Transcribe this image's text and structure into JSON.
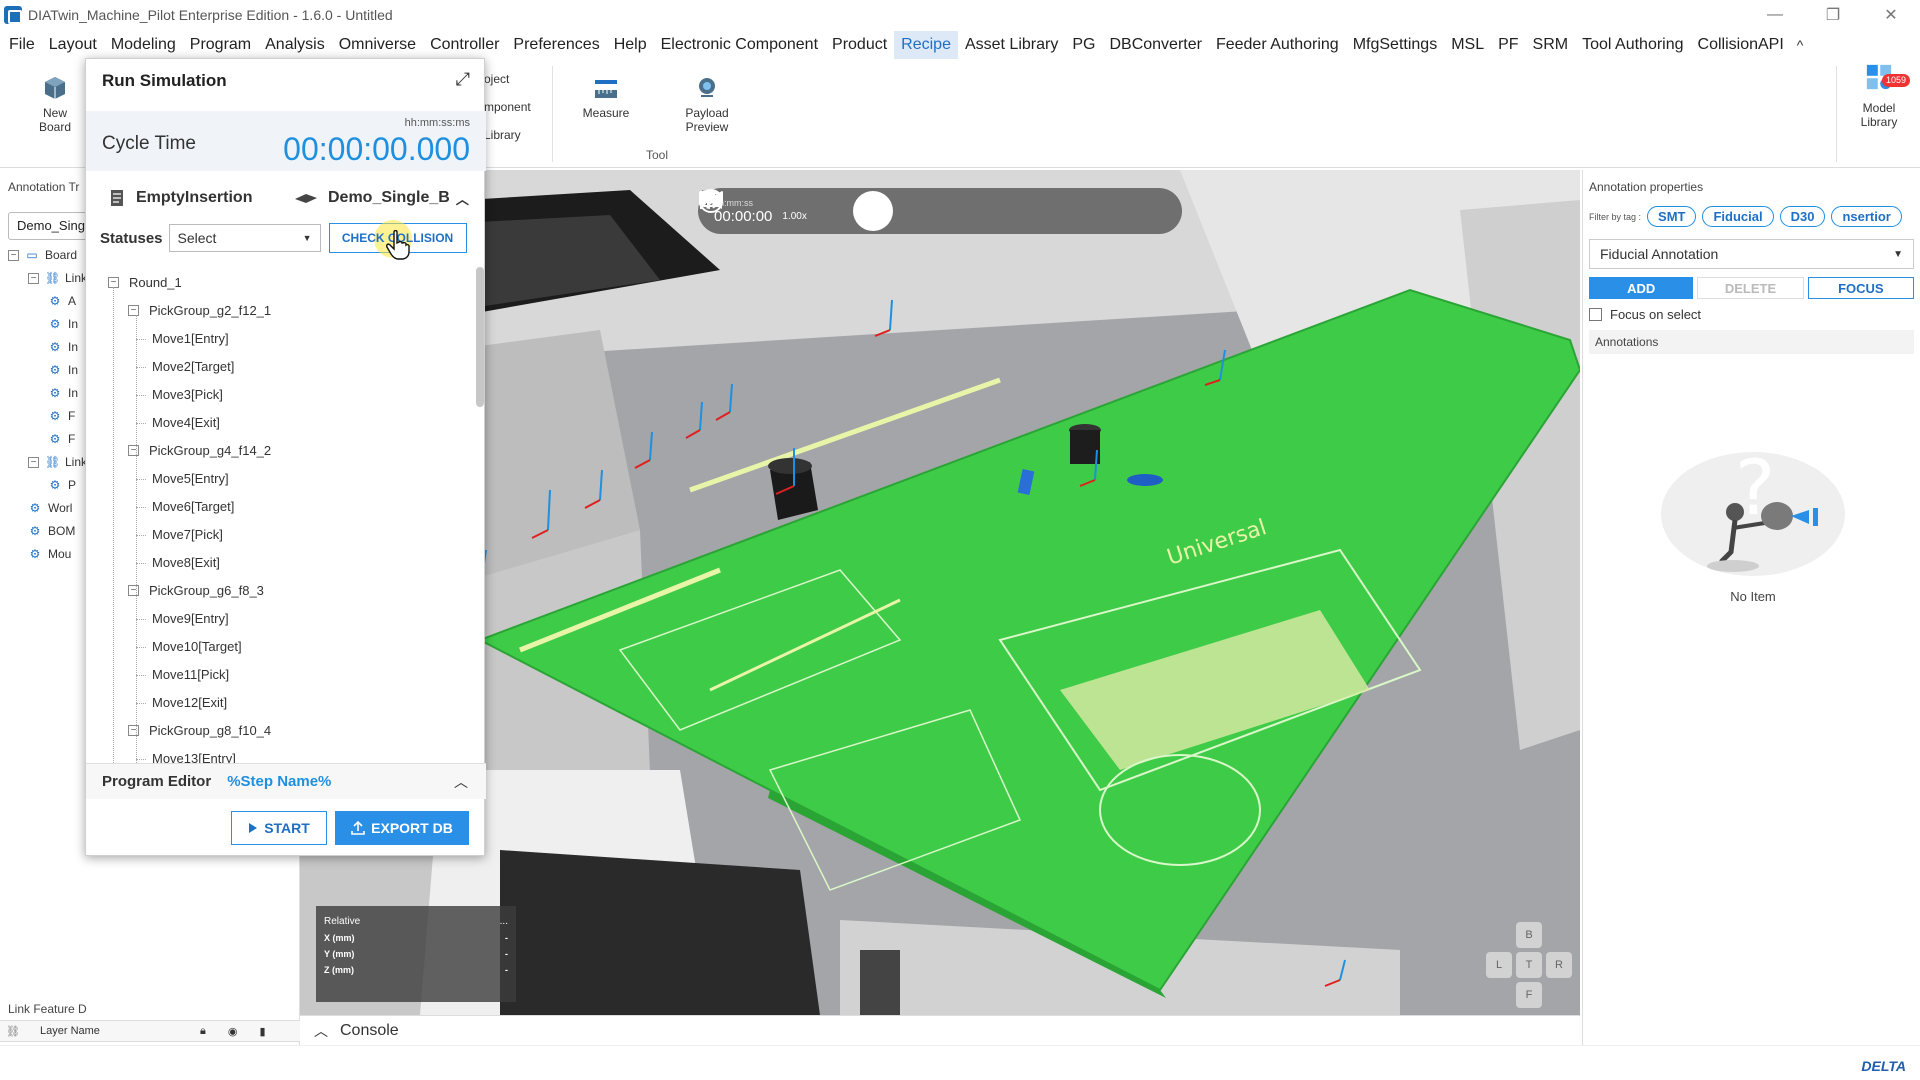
{
  "window": {
    "title": "DIATwin_Machine_Pilot Enterprise Edition - 1.6.0 - Untitled",
    "minimize_icon": "—",
    "restore_icon": "❐",
    "close_icon": "✕"
  },
  "menu": {
    "items": [
      "File",
      "Layout",
      "Modeling",
      "Program",
      "Analysis",
      "Omniverse",
      "Controller",
      "Preferences",
      "Help",
      "Electronic Component",
      "Product",
      "Recipe",
      "Asset Library",
      "PG",
      "DBConverter",
      "Feeder Authoring",
      "MfgSettings",
      "MSL",
      "PF",
      "SRM",
      "Tool Authoring",
      "CollisionAPI"
    ],
    "active": "Recipe",
    "collapse_icon": "^"
  },
  "ribbon": {
    "new_board": "New\nBoard",
    "object_frag": "oject",
    "component_frag": "mponent",
    "library_frag": "Library",
    "measure": "Measure",
    "payload_preview": "Payload\nPreview",
    "tool_group": "Tool",
    "model_library": "Model\nLibrary",
    "model_library_badge": "1059"
  },
  "left_panel": {
    "header": "Annotation Tr",
    "combo_value": "Demo_Sing",
    "tree": [
      {
        "label": "Board",
        "level": 0,
        "toggle": "-"
      },
      {
        "label": "Link_",
        "level": 1,
        "toggle": "-"
      },
      {
        "label": "A",
        "level": 2
      },
      {
        "label": "In",
        "level": 2
      },
      {
        "label": "In",
        "level": 2
      },
      {
        "label": "In",
        "level": 2
      },
      {
        "label": "In",
        "level": 2
      },
      {
        "label": "F",
        "level": 2
      },
      {
        "label": "F",
        "level": 2
      },
      {
        "label": "Link_",
        "level": 1,
        "toggle": "-"
      },
      {
        "label": "P",
        "level": 2
      },
      {
        "label": "Worl",
        "level": 1
      },
      {
        "label": "BOM",
        "level": 1
      },
      {
        "label": "Mou",
        "level": 1
      }
    ],
    "link_feature_title": "Link Feature D",
    "layer_col": "Layer Name"
  },
  "viewport": {
    "playbar": {
      "unit": "hh:mm:ss",
      "time": "00:00:00",
      "speed": "1.00x"
    },
    "coords": {
      "title": "Relative",
      "x_label": "X (mm)",
      "y_label": "Y (mm)",
      "z_label": "Z (mm)",
      "x_val": "-",
      "y_val": "-",
      "z_val": "-",
      "menu": "..."
    },
    "viewcube": {
      "back": "B",
      "left": "L",
      "top": "T",
      "right": "R",
      "front": "F"
    },
    "pcb_color": "#3ecb48"
  },
  "console": {
    "label": "Console"
  },
  "right_panel": {
    "title": "Annotation properties",
    "filter_label": "Filter by tag :",
    "tags": [
      "SMT",
      "Fiducial",
      "D30",
      "nsertior"
    ],
    "annotation_type": "Fiducial Annotation",
    "add": "ADD",
    "delete": "DELETE",
    "focus": "FOCUS",
    "focus_on_select": "Focus on select",
    "annotations_section": "Annotations",
    "empty_text": "No Item"
  },
  "sim_dialog": {
    "title": "Run Simulation",
    "cycle_label": "Cycle Time",
    "cycle_unit": "hh:mm:ss:ms",
    "cycle_value": "00:00:00.000",
    "recipe_name": "EmptyInsertion",
    "board_name": "Demo_Single_B",
    "statuses_label": "Statuses",
    "statuses_value": "Select",
    "check_collision": "CHECK COLLISION",
    "tree": [
      {
        "label": "Round_1",
        "kind": "round"
      },
      {
        "label": "PickGroup_g2_f12_1",
        "kind": "group"
      },
      {
        "label": "Move1[Entry]",
        "kind": "move"
      },
      {
        "label": "Move2[Target]",
        "kind": "move"
      },
      {
        "label": "Move3[Pick]",
        "kind": "move"
      },
      {
        "label": "Move4[Exit]",
        "kind": "move"
      },
      {
        "label": "PickGroup_g4_f14_2",
        "kind": "group"
      },
      {
        "label": "Move5[Entry]",
        "kind": "move"
      },
      {
        "label": "Move6[Target]",
        "kind": "move"
      },
      {
        "label": "Move7[Pick]",
        "kind": "move"
      },
      {
        "label": "Move8[Exit]",
        "kind": "move"
      },
      {
        "label": "PickGroup_g6_f8_3",
        "kind": "group"
      },
      {
        "label": "Move9[Entry]",
        "kind": "move"
      },
      {
        "label": "Move10[Target]",
        "kind": "move"
      },
      {
        "label": "Move11[Pick]",
        "kind": "move"
      },
      {
        "label": "Move12[Exit]",
        "kind": "move"
      },
      {
        "label": "PickGroup_g8_f10_4",
        "kind": "group"
      },
      {
        "label": "Move13[Entry]",
        "kind": "move"
      }
    ],
    "program_editor_label": "Program Editor",
    "program_editor_value": "%Step Name%",
    "start": "START",
    "export_db": "EXPORT DB"
  },
  "status": {
    "brand": "DELTA"
  },
  "colors": {
    "accent": "#2a8fe6",
    "accent_text": "#1f6fc5",
    "pcb": "#3ecb48"
  }
}
